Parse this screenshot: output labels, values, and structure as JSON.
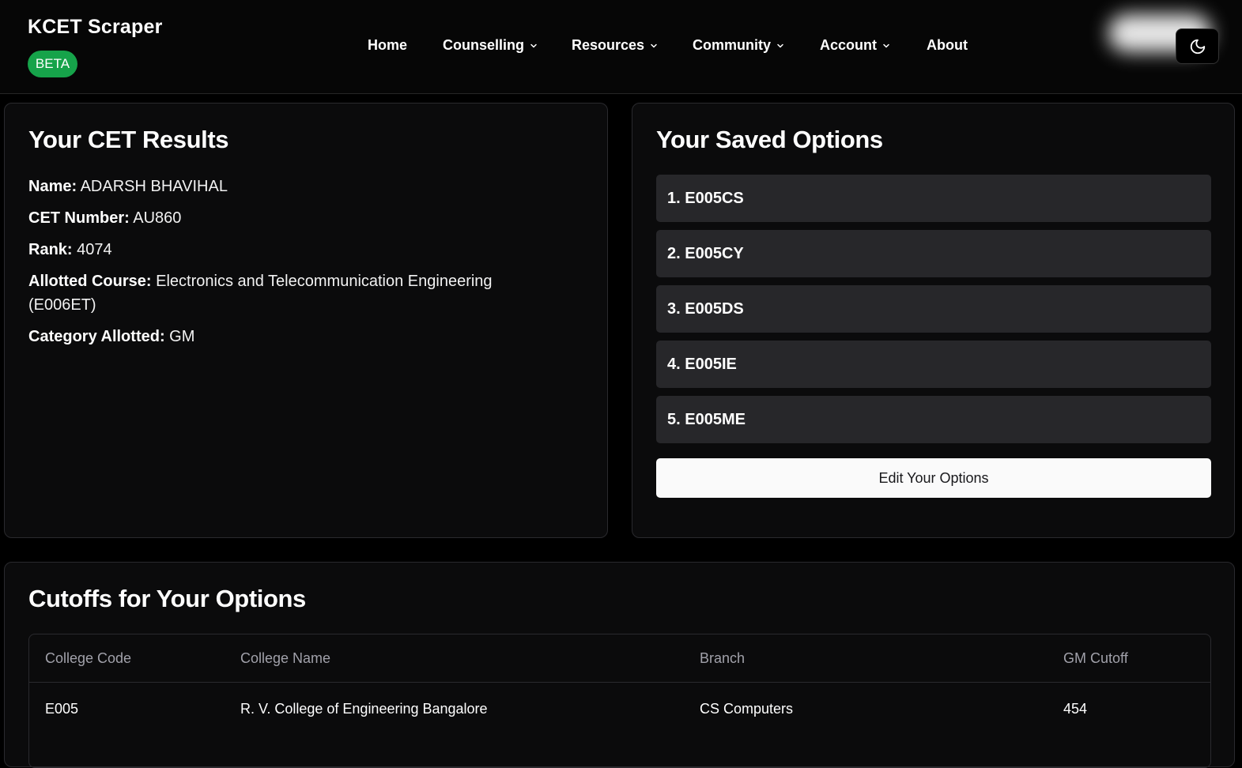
{
  "header": {
    "brand": "KCET Scraper",
    "badge": "BETA",
    "nav": [
      {
        "label": "Home",
        "has_dropdown": false
      },
      {
        "label": "Counselling",
        "has_dropdown": true
      },
      {
        "label": "Resources",
        "has_dropdown": true
      },
      {
        "label": "Community",
        "has_dropdown": true
      },
      {
        "label": "Account",
        "has_dropdown": true
      },
      {
        "label": "About",
        "has_dropdown": false
      }
    ],
    "theme_icon": "moon-icon"
  },
  "results": {
    "title": "Your CET Results",
    "fields": [
      {
        "label": "Name:",
        "value": "ADARSH BHAVIHAL"
      },
      {
        "label": "CET Number:",
        "value": "AU860"
      },
      {
        "label": "Rank:",
        "value": "4074"
      },
      {
        "label": "Allotted Course:",
        "value": "Electronics and Telecommunication Engineering (E006ET)"
      },
      {
        "label": "Category Allotted:",
        "value": "GM"
      }
    ]
  },
  "options": {
    "title": "Your Saved Options",
    "items": [
      "1. E005CS",
      "2. E005CY",
      "3. E005DS",
      "4. E005IE",
      "5. E005ME"
    ],
    "edit_label": "Edit Your Options"
  },
  "cutoffs": {
    "title": "Cutoffs for Your Options",
    "columns": [
      "College Code",
      "College Name",
      "Branch",
      "GM Cutoff"
    ],
    "rows": [
      [
        "E005",
        "R. V. College of Engineering Bangalore",
        "CS Computers",
        "454"
      ]
    ]
  },
  "colors": {
    "background": "#000000",
    "card": "#0b0b0c",
    "option_row": "#27272a",
    "badge": "#16a34a",
    "button": "#fafafa"
  }
}
